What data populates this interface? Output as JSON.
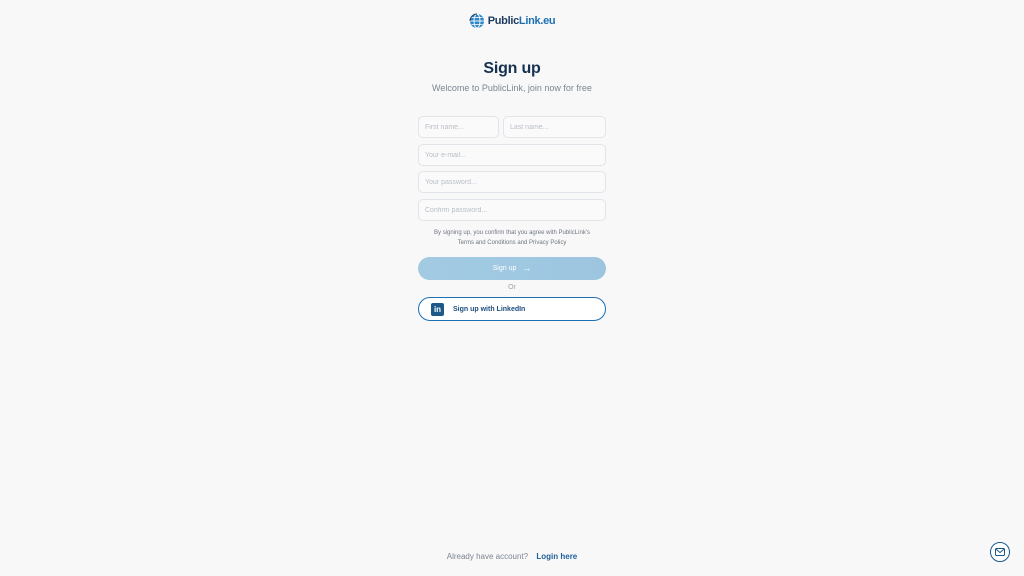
{
  "brand": {
    "name_part1": "Public",
    "name_part2": "Link.eu",
    "globe_icon": "globe-icon"
  },
  "header": {
    "title": "Sign up",
    "subtitle": "Welcome to PublicLink, join now for free"
  },
  "form": {
    "first_name": {
      "placeholder": "First name...",
      "value": ""
    },
    "last_name": {
      "placeholder": "Last name...",
      "value": ""
    },
    "email": {
      "placeholder": "Your e-mail...",
      "value": ""
    },
    "password": {
      "placeholder": "Your password...",
      "value": ""
    },
    "confirm_password": {
      "placeholder": "Confirm password...",
      "value": ""
    },
    "terms_prefix": "By signing up, you confirm that you agree with PublicLink's",
    "terms_link": "Terms and Conditions",
    "terms_and": "and",
    "privacy_link": "Privacy Policy",
    "submit_label": "Sign up",
    "submit_icon": "arrow-right-icon",
    "or_label": "Or",
    "linkedin_label": "Sign up with LinkedIn",
    "linkedin_icon": "linkedin-icon"
  },
  "footer": {
    "prompt": "Already have account?",
    "login_label": "Login here"
  },
  "floating": {
    "contact_icon": "mail-icon"
  },
  "colors": {
    "primary": "#1d6fb3",
    "heading": "#15314f",
    "button_disabled": "#a2cbe3",
    "background": "#f8f8f9"
  }
}
